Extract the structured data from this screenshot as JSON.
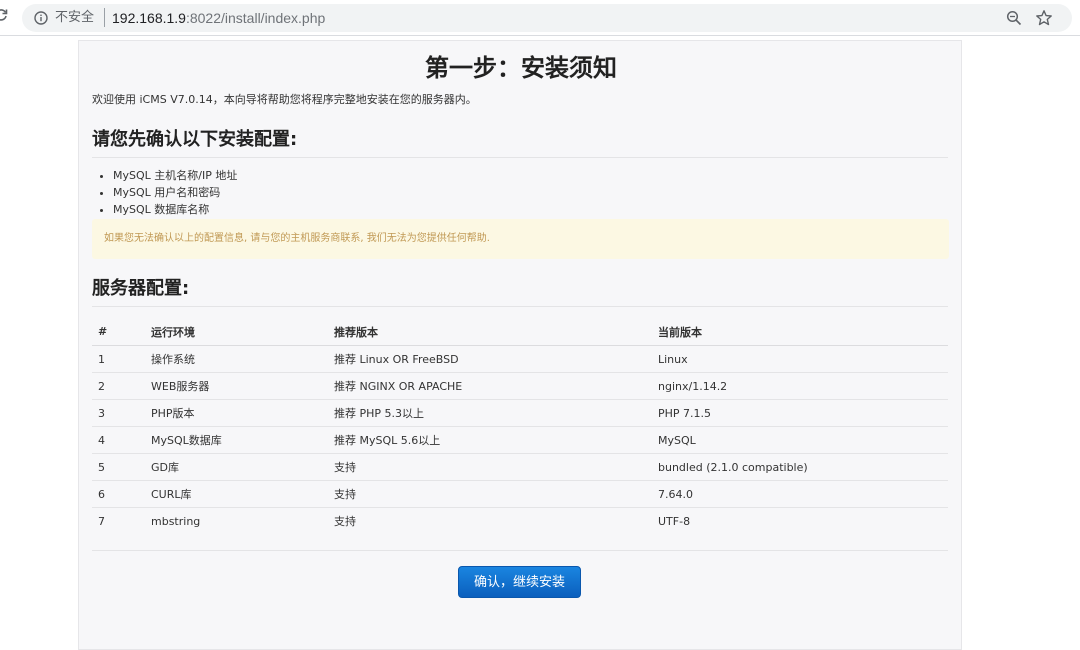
{
  "browser": {
    "security_label": "不安全",
    "url_host": "192.168.1.9",
    "url_path": ":8022/install/index.php"
  },
  "page": {
    "title": "第一步：安装须知",
    "welcome": "欢迎使用 iCMS V7.0.14，本向导将帮助您将程序完整地安装在您的服务器内。",
    "confirm_heading": "请您先确认以下安装配置:",
    "requirements": [
      "MySQL 主机名称/IP 地址",
      "MySQL 用户名和密码",
      "MySQL 数据库名称"
    ],
    "warning": "如果您无法确认以上的配置信息, 请与您的主机服务商联系, 我们无法为您提供任何帮助.",
    "server_heading": "服务器配置:",
    "table": {
      "headers": [
        "#",
        "运行环境",
        "推荐版本",
        "当前版本"
      ],
      "rows": [
        [
          "1",
          "操作系统",
          "推荐 Linux OR FreeBSD",
          "Linux"
        ],
        [
          "2",
          "WEB服务器",
          "推荐 NGINX OR APACHE",
          "nginx/1.14.2"
        ],
        [
          "3",
          "PHP版本",
          "推荐 PHP 5.3以上",
          "PHP 7.1.5"
        ],
        [
          "4",
          "MySQL数据库",
          "推荐 MySQL 5.6以上",
          "MySQL"
        ],
        [
          "5",
          "GD库",
          "支持",
          "bundled (2.1.0 compatible)"
        ],
        [
          "6",
          "CURL库",
          "支持",
          "7.64.0"
        ],
        [
          "7",
          "mbstring",
          "支持",
          "UTF-8"
        ]
      ]
    },
    "continue_button": "确认，继续安装"
  },
  "icons": {
    "reload": "reload-icon",
    "info": "info-icon",
    "zoom": "zoom-icon",
    "bookmark": "star-icon"
  },
  "colors": {
    "primary_button": "#0e6fcf",
    "warning_bg": "#fcf8e3",
    "warning_text": "#c09853",
    "panel_bg": "#f7f7f9"
  }
}
